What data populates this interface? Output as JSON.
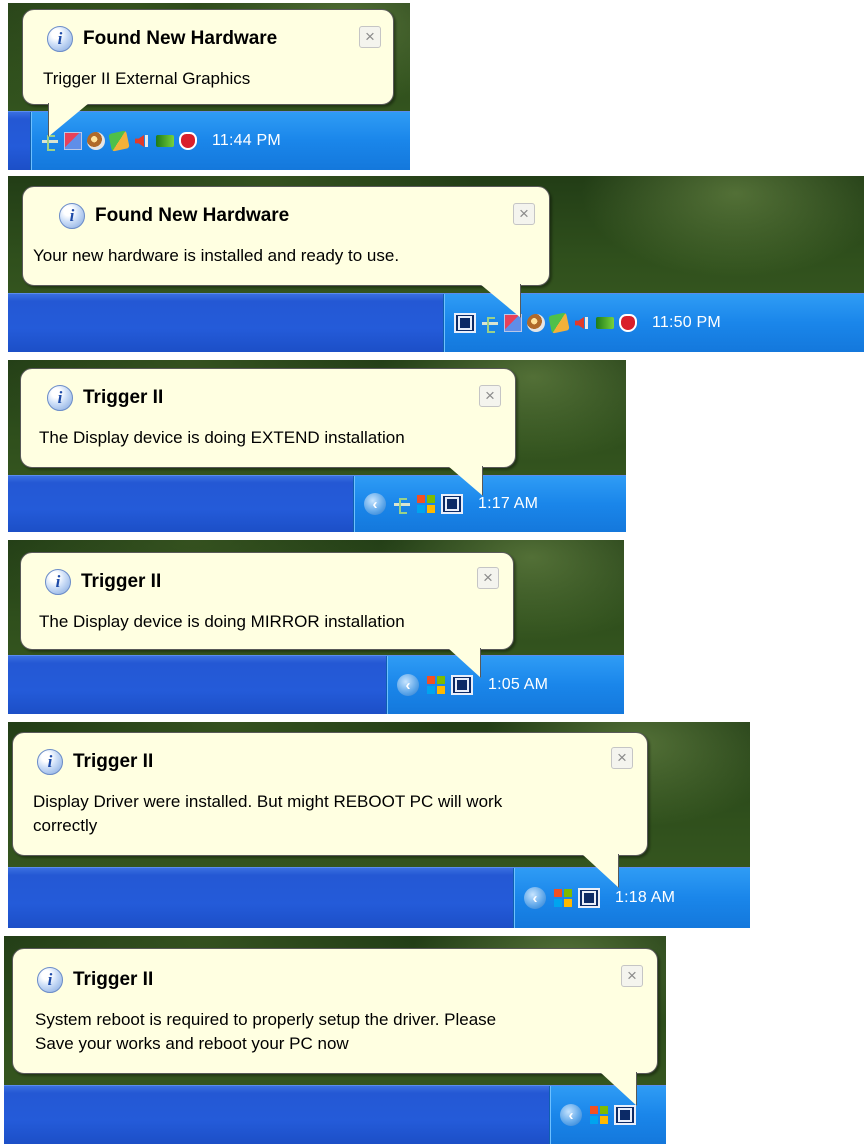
{
  "balloons": [
    {
      "title": "Found New Hardware",
      "message": "Trigger II External Graphics",
      "close_glyph": "×",
      "clock": "11:44 PM",
      "tray_icons": [
        "usb-icon",
        "network-icon",
        "disc-icon",
        "green-app-icon",
        "speaker-icon",
        "nvidia-icon",
        "security-shield-icon"
      ]
    },
    {
      "title": "Found New Hardware",
      "message": "Your new hardware is installed and ready to use.",
      "close_glyph": "×",
      "clock": "11:50 PM",
      "tray_icons": [
        "display-adapter-icon",
        "usb-icon",
        "network-icon",
        "disc-icon",
        "green-app-icon",
        "speaker-icon",
        "nvidia-icon",
        "security-shield-icon"
      ]
    },
    {
      "title": "Trigger II",
      "message": "The Display device is doing EXTEND installation",
      "close_glyph": "×",
      "clock": "1:17 AM",
      "tray_icons": [
        "chevron-left-icon",
        "usb-icon",
        "windows-icon",
        "display-adapter-icon"
      ]
    },
    {
      "title": "Trigger II",
      "message": "The Display device is doing MIRROR installation",
      "close_glyph": "×",
      "clock": "1:05 AM",
      "tray_icons": [
        "chevron-left-icon",
        "windows-icon",
        "display-adapter-icon"
      ]
    },
    {
      "title": "Trigger II",
      "message_line1": "Display Driver were installed. But might REBOOT PC will work",
      "message_line2": "correctly",
      "close_glyph": "×",
      "clock": "1:18 AM",
      "tray_icons": [
        "chevron-left-icon",
        "windows-icon",
        "display-adapter-icon"
      ]
    },
    {
      "title": "Trigger II",
      "message_line1": "System reboot is required to properly setup the driver. Please",
      "message_line2": "Save your works and reboot your PC now",
      "close_glyph": "×",
      "tray_icons": [
        "chevron-left-icon",
        "windows-icon",
        "display-adapter-icon"
      ]
    }
  ],
  "colors": {
    "balloon_bg": "#ffffe1",
    "taskbar_blue": "#245bd9",
    "tray_blue": "#1a86ea",
    "desktop_green": "#2f4f1c"
  }
}
